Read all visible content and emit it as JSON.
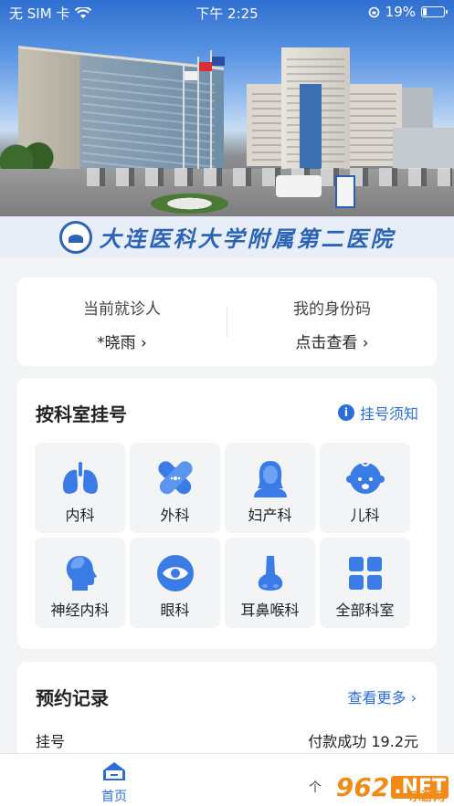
{
  "status_bar": {
    "carrier": "无 SIM 卡",
    "time": "下午 2:25",
    "battery": "19%",
    "battery_level": 0.19
  },
  "banner": {
    "hospital_name": "大连医科大学附属第二医院"
  },
  "patient_card": {
    "current_patient_label": "当前就诊人",
    "current_patient_value": "*晓雨",
    "id_code_label": "我的身份码",
    "id_code_value": "点击查看"
  },
  "department": {
    "title": "按科室挂号",
    "notice_label": "挂号须知",
    "items": [
      {
        "label": "内科",
        "icon": "lungs-icon"
      },
      {
        "label": "外科",
        "icon": "bandage-icon"
      },
      {
        "label": "妇产科",
        "icon": "woman-icon"
      },
      {
        "label": "儿科",
        "icon": "baby-icon"
      },
      {
        "label": "神经内科",
        "icon": "head-icon"
      },
      {
        "label": "眼科",
        "icon": "eye-icon"
      },
      {
        "label": "耳鼻喉科",
        "icon": "nose-icon"
      },
      {
        "label": "全部科室",
        "icon": "grid-icon"
      }
    ]
  },
  "records": {
    "title": "预约记录",
    "more_label": "查看更多",
    "row_type": "挂号",
    "row_status": "付款成功 19.2元"
  },
  "tabbar": {
    "home_label": "首页",
    "me_label": "个"
  },
  "watermark": {
    "main": "962",
    "net": ".NET",
    "sub": "乐游网"
  },
  "colors": {
    "accent": "#2b6ed9",
    "background": "#f3f4f6",
    "watermark": "#f08a18"
  }
}
